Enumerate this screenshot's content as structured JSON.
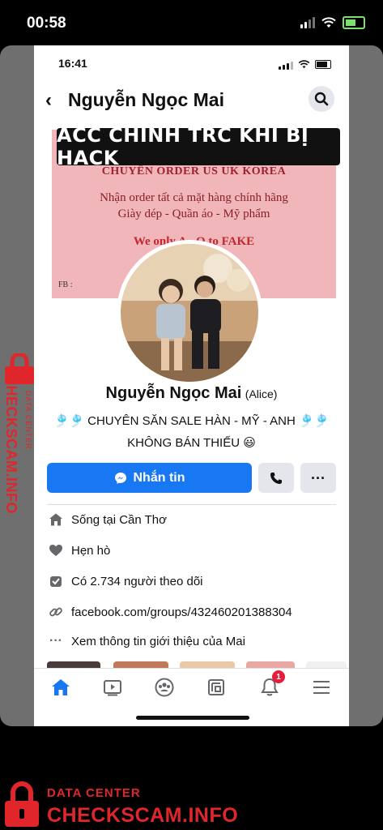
{
  "outer_status": {
    "time": "00:58"
  },
  "inner_status": {
    "time": "16:41"
  },
  "header": {
    "title": "Nguyễn Ngọc Mai"
  },
  "overlay_label": "ACC CHÍNH TRC KHI BỊ HACK",
  "cover": {
    "line1": "CHUYÊN ORDER US UK KOREA",
    "line2": "Nhận order tất cả mặt hàng chính hãng",
    "line3": "Giày dép - Quần áo - Mỹ phẩm",
    "line4": "We only A...O to FAKE",
    "line5": "FB :"
  },
  "profile": {
    "name": "Nguyễn Ngọc Mai",
    "alias": "(Alice)",
    "bio_line1": "🎐🎐 CHUYÊN SĂN SALE HÀN - MỸ - ANH 🎐🎐",
    "bio_line2": "KHÔNG BÁN THIẾU 😃"
  },
  "actions": {
    "message_label": "Nhắn tin"
  },
  "info": [
    {
      "icon": "home-icon",
      "text": "Sống tại Cần Thơ"
    },
    {
      "icon": "heart-icon",
      "text": "Hẹn hò"
    },
    {
      "icon": "followers-icon",
      "text": "Có 2.734 người theo dõi"
    },
    {
      "icon": "link-icon",
      "text": "facebook.com/groups/432460201388304"
    },
    {
      "icon": "more-icon",
      "text": "Xem thông tin giới thiệu của Mai"
    }
  ],
  "tabbar": {
    "notification_badge": "1"
  },
  "watermark": {
    "sub": "DATA CENTER",
    "main": "CHECKSCAM.INFO"
  },
  "colors": {
    "facebook_blue": "#1877f2",
    "watermark_red": "#e0262b",
    "cover_pink": "#f1b6b9"
  }
}
